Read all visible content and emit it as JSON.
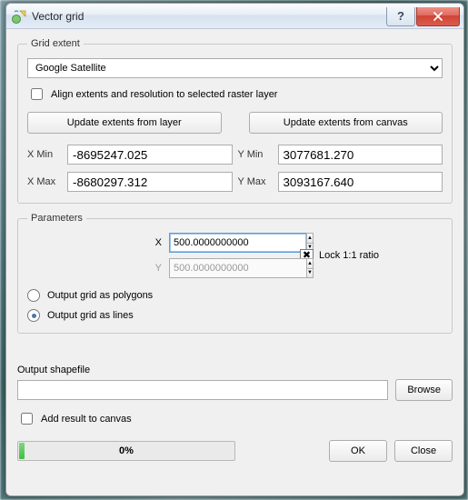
{
  "window": {
    "title": "Vector grid"
  },
  "grid_extent": {
    "legend": "Grid extent",
    "layer": "Google Satellite",
    "align_label": "Align extents and resolution to selected raster layer",
    "update_from_layer": "Update extents from layer",
    "update_from_canvas": "Update extents from canvas",
    "xmin_label": "X Min",
    "xmin": "-8695247.025",
    "ymin_label": "Y Min",
    "ymin": "3077681.270",
    "xmax_label": "X Max",
    "xmax": "-8680297.312",
    "ymax_label": "Y Max",
    "ymax": "3093167.640"
  },
  "parameters": {
    "legend": "Parameters",
    "x_label": "X",
    "x_value": "500.0000000000",
    "y_label": "Y",
    "y_value": "500.0000000000",
    "lock_label": "Lock 1:1 ratio",
    "lock_checked": true,
    "output_mode": "lines",
    "polygons_label": "Output grid as polygons",
    "lines_label": "Output grid as lines"
  },
  "output": {
    "label": "Output shapefile",
    "value": "",
    "browse": "Browse",
    "add_result_label": "Add result to canvas"
  },
  "footer": {
    "progress_percent": "0%",
    "ok": "OK",
    "close": "Close"
  }
}
